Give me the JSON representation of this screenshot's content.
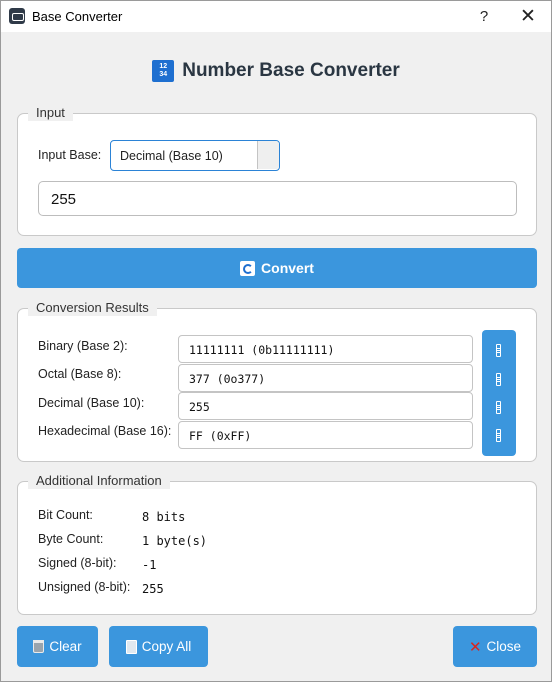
{
  "window": {
    "title": "Base Converter",
    "help": "?",
    "close": "✕"
  },
  "header": {
    "title": "Number Base Converter",
    "icon_top": "12",
    "icon_bottom": "34",
    "icon_name": "number-base-icon"
  },
  "input": {
    "group_label": "Input",
    "base_label": "Input Base:",
    "base_selected": "Decimal (Base 10)",
    "value": "255"
  },
  "convert_button": {
    "label": "Convert",
    "icon": "refresh-icon"
  },
  "results": {
    "group_label": "Conversion Results",
    "rows": [
      {
        "label": "Binary (Base 2):",
        "value": "11111111 (0b11111111)"
      },
      {
        "label": "Octal (Base 8):",
        "value": "377 (0o377)"
      },
      {
        "label": "Decimal (Base 10):",
        "value": "255"
      },
      {
        "label": "Hexadecimal (Base 16):",
        "value": "FF (0xFF)"
      }
    ]
  },
  "info": {
    "group_label": "Additional Information",
    "rows": [
      {
        "label": "Bit Count:",
        "value": "8 bits"
      },
      {
        "label": "Byte Count:",
        "value": "1 byte(s)"
      },
      {
        "label": "Signed (8-bit):",
        "value": "-1"
      },
      {
        "label": "Unsigned (8-bit):",
        "value": "255"
      }
    ]
  },
  "buttons": {
    "clear": "Clear",
    "copy_all": "Copy All",
    "close": "Close"
  },
  "colors": {
    "accent": "#3b96dd",
    "title": "#2a3642",
    "close_icon": "#d9251d"
  }
}
